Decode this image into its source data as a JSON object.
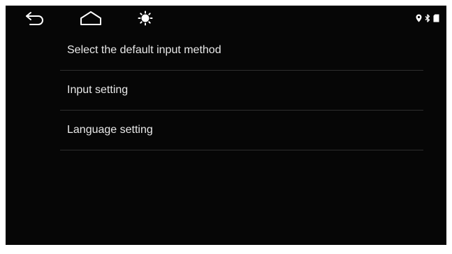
{
  "nav": {
    "back_icon": "back-arrow-icon",
    "home_icon": "home-icon",
    "brightness_icon": "brightness-icon"
  },
  "status": {
    "location_icon": "location-pin-icon",
    "bluetooth_icon": "bluetooth-icon",
    "sd_card_icon": "sd-card-icon"
  },
  "menu": {
    "items": [
      {
        "label": "Select the default input method"
      },
      {
        "label": "Input setting"
      },
      {
        "label": "Language setting"
      }
    ]
  },
  "colors": {
    "background": "#060606",
    "text": "#e9e9e9",
    "divider": "#2e2e2e",
    "icon": "#ffffff"
  }
}
